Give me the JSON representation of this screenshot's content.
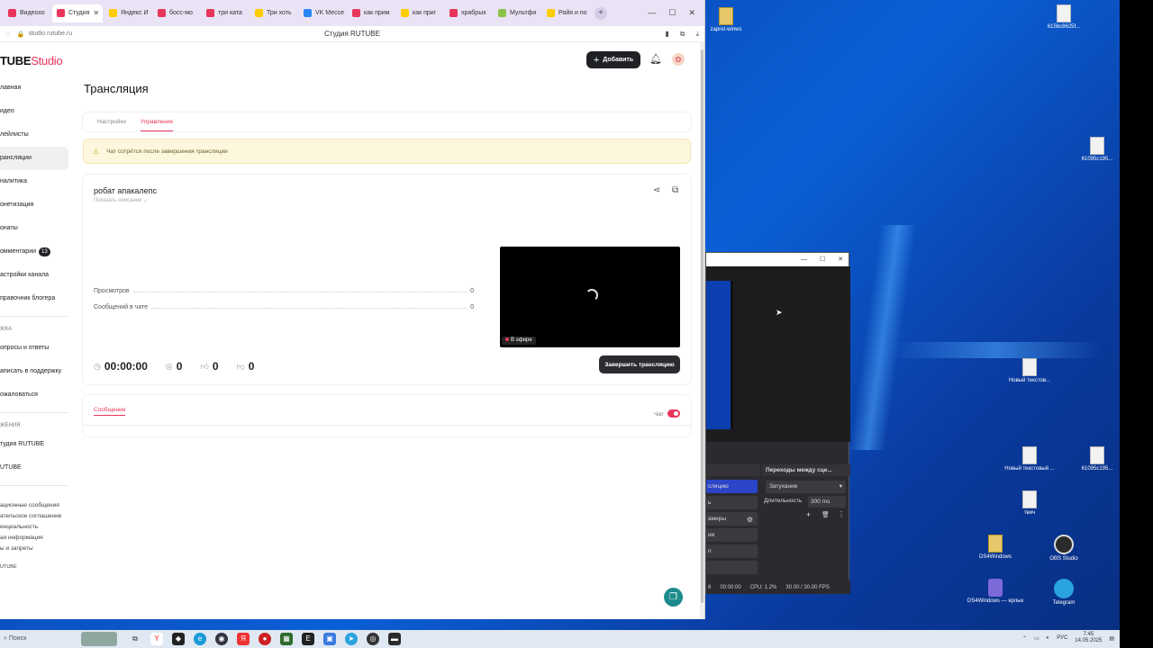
{
  "browser": {
    "tabs": [
      {
        "label": "Видеохо",
        "color": "#e8365a"
      },
      {
        "label": "Студия",
        "color": "#e8365a",
        "active": true
      },
      {
        "label": "Яндекс И",
        "color": "#ffcc00"
      },
      {
        "label": "босс-мо",
        "color": "#e8365a"
      },
      {
        "label": "три ката",
        "color": "#e8365a"
      },
      {
        "label": "Три хоть",
        "color": "#ffcc00"
      },
      {
        "label": "VK Мессе",
        "color": "#2787f5"
      },
      {
        "label": "как прим",
        "color": "#e8365a"
      },
      {
        "label": "как приг",
        "color": "#ffcc00"
      },
      {
        "label": "храбрых",
        "color": "#e8365a"
      },
      {
        "label": "Мультфи",
        "color": "#8bc34a"
      },
      {
        "label": "Райя и по",
        "color": "#ffcc00"
      }
    ],
    "url": "studio.rutube.ru",
    "page_title": "Студия RUTUBE"
  },
  "studio": {
    "logo_main": "TUBE",
    "logo_studio": "Studio",
    "add_button": "Добавить",
    "sidebar": {
      "items": [
        {
          "label": "лавная"
        },
        {
          "label": "идео"
        },
        {
          "label": "лейлисты"
        },
        {
          "label": "рансляции",
          "active": true
        },
        {
          "label": "налитика"
        },
        {
          "label": "онетизация"
        },
        {
          "label": "онаты"
        },
        {
          "label": "омментарии",
          "badge": "13"
        },
        {
          "label": "астройки канала"
        },
        {
          "label": "правочник блогера"
        }
      ],
      "support_heading": "ЖКА",
      "support_items": [
        {
          "label": "опросы и ответы"
        },
        {
          "label": "аписать в поддержку"
        },
        {
          "label": "ожаловаться"
        }
      ],
      "apps_heading": "ЖЕНИЯ",
      "apps_items": [
        {
          "label": "тудия RUTUBE"
        },
        {
          "label": "UTUBE"
        }
      ],
      "footer_links": [
        "ационные сообщения",
        "ательское соглашение",
        "енциальность",
        "ая информация",
        "ы и запреты"
      ],
      "footer_brand": "UTUBE"
    },
    "page_title": "Трансляция",
    "tabs": {
      "settings": "Настройки",
      "control": "Управление"
    },
    "notice": "Чат сотрётся после завершения трансляции",
    "stream": {
      "title": "робат апакалепс",
      "show_description": "Показать описание",
      "views_label": "Просмотров",
      "views_value": "0",
      "chat_messages_label": "Сообщений в чате",
      "chat_messages_value": "0",
      "live_label": "В эфире",
      "duration": "00:00:00",
      "comments": "0",
      "likes": "0",
      "dislikes": "0",
      "end_button": "Завершить трансляцию"
    },
    "chat": {
      "messages_tab": "Сообщения",
      "chat_label": "Чат",
      "enabled": true
    }
  },
  "obs": {
    "transitions_header": "Переходы между сце...",
    "transition_type": "Затухание",
    "duration_label": "Длительность",
    "duration_value": "300 ms",
    "controls": [
      {
        "label": "сляцию",
        "active": true
      },
      {
        "label": "ь"
      },
      {
        "label": "амеры"
      },
      {
        "label": "ии"
      },
      {
        "label": "п"
      },
      {
        "label": ""
      }
    ],
    "status_rec": "8",
    "status_time": "00:00:00",
    "status_cpu": "CPU: 1.2%",
    "status_fps": "30.00 / 30.00 FPS"
  },
  "desktop": {
    "icons": [
      {
        "label": "zapret-winws",
        "kind": "folder"
      },
      {
        "label": "615bc8625f...",
        "kind": "file"
      },
      {
        "label": "61095c195...",
        "kind": "file"
      },
      {
        "label": "Новый текстов...",
        "kind": "file"
      },
      {
        "label": "Новый текстовый ...",
        "kind": "file"
      },
      {
        "label": "61095c195...",
        "kind": "file"
      },
      {
        "label": "твич",
        "kind": "file"
      },
      {
        "label": "DS4Windows",
        "kind": "folder"
      },
      {
        "label": "OBS Studio",
        "kind": "round"
      },
      {
        "label": "DS4Windows — ярлык",
        "kind": "ds4"
      },
      {
        "label": "Telegram",
        "kind": "tg"
      }
    ]
  },
  "taskbar": {
    "search": "Поиск",
    "lang": "РУС",
    "time": "7:45",
    "date": "14.05.2025"
  }
}
